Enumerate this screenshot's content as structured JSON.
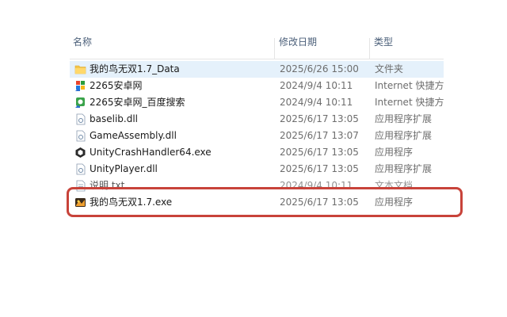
{
  "header": {
    "name_label": "名称",
    "date_label": "修改日期",
    "type_label": "类型"
  },
  "files": [
    {
      "name": "我的鸟无双1.7_Data",
      "date": "2025/6/26 15:00",
      "type": "文件夹",
      "icon": "folder-icon",
      "selected": true
    },
    {
      "name": "2265安卓网",
      "date": "2024/9/4 10:11",
      "type": "Internet 快捷方式",
      "icon": "internet-shortcut-icon"
    },
    {
      "name": "2265安卓网_百度搜索",
      "date": "2024/9/4 10:11",
      "type": "Internet 快捷方式",
      "icon": "internet-shortcut-icon"
    },
    {
      "name": "baselib.dll",
      "date": "2025/6/17 13:05",
      "type": "应用程序扩展",
      "icon": "dll-icon"
    },
    {
      "name": "GameAssembly.dll",
      "date": "2025/6/17 13:07",
      "type": "应用程序扩展",
      "icon": "dll-icon"
    },
    {
      "name": "UnityCrashHandler64.exe",
      "date": "2025/6/17 13:05",
      "type": "应用程序",
      "icon": "unity-icon"
    },
    {
      "name": "UnityPlayer.dll",
      "date": "2025/6/17 13:05",
      "type": "应用程序扩展",
      "icon": "dll-icon"
    },
    {
      "name": "说明.txt",
      "date": "2024/9/4 10:11",
      "type": "文本文档",
      "icon": "text-file-icon"
    },
    {
      "name": "我的鸟无双1.7.exe",
      "date": "2025/6/17 13:05",
      "type": "应用程序",
      "icon": "game-exe-icon"
    }
  ],
  "colors": {
    "selection": "#e5f1fb",
    "highlight_border": "#c8433a",
    "folder": "#f4c54a"
  }
}
